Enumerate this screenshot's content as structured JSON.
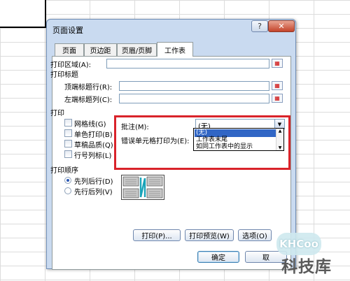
{
  "dialog": {
    "title": "页面设置",
    "help_glyph": "?",
    "close_glyph": "✕"
  },
  "tabs": [
    {
      "label": "页面"
    },
    {
      "label": "页边距"
    },
    {
      "label": "页眉/页脚"
    },
    {
      "label": "工作表",
      "active": true
    }
  ],
  "print_area": {
    "label": "打印区域(A):",
    "value": ""
  },
  "print_titles": {
    "heading": "打印标题",
    "top_rows": {
      "label": "顶端标题行(R):",
      "value": ""
    },
    "left_cols": {
      "label": "左端标题列(C):",
      "value": ""
    }
  },
  "print": {
    "heading": "打印",
    "checkboxes": [
      {
        "label": "网格线(G)",
        "checked": false
      },
      {
        "label": "单色打印(B)",
        "checked": false
      },
      {
        "label": "草稿品质(Q)",
        "checked": false
      },
      {
        "label": "行号列标(L)",
        "checked": false
      }
    ],
    "comments": {
      "label": "批注(M):",
      "value": "(无)"
    },
    "cell_errors": {
      "label": "错误单元格打印为(E):"
    },
    "dropdown_options": [
      {
        "label": "(无)",
        "highlighted": true
      },
      {
        "label": "工作表末尾",
        "highlighted": false
      },
      {
        "label": "如同工作表中的显示",
        "highlighted": false
      }
    ]
  },
  "page_order": {
    "heading": "打印顺序",
    "options": [
      {
        "label": "先列后行(D)",
        "selected": true
      },
      {
        "label": "先行后列(V)",
        "selected": false
      }
    ]
  },
  "buttons": {
    "print": "打印(P)...",
    "preview": "打印预览(W)",
    "options": "选项(O)",
    "ok": "确定",
    "cancel": "取"
  },
  "watermark": {
    "badge": "KHCoo",
    "text": "科技库"
  },
  "colors": {
    "highlight_box": "#d9232a",
    "selection": "#3166c5"
  }
}
